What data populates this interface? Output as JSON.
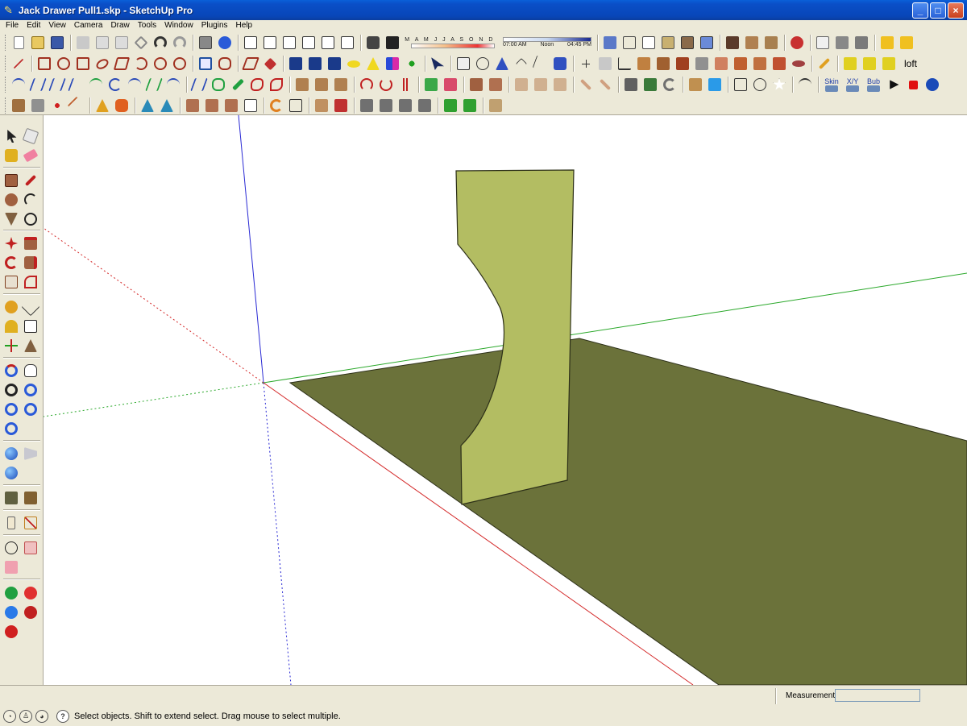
{
  "window": {
    "title": "Jack Drawer Pull1.skp - SketchUp Pro",
    "minimize_glyph": "_",
    "maximize_glyph": "□",
    "close_glyph": "×"
  },
  "menu": {
    "items": [
      {
        "label": "File"
      },
      {
        "label": "Edit"
      },
      {
        "label": "View"
      },
      {
        "label": "Camera"
      },
      {
        "label": "Draw"
      },
      {
        "label": "Tools"
      },
      {
        "label": "Window"
      },
      {
        "label": "Plugins"
      },
      {
        "label": "Help"
      }
    ]
  },
  "shadows": {
    "months": "J F M A M J J A S O N D",
    "time_start": "07:00 AM",
    "time_noon": "Noon",
    "time_end": "04:45 PM"
  },
  "plugin_labels": {
    "skin": "Skin",
    "xy": "X/Y",
    "bub": "Bub",
    "loft": "loft"
  },
  "status": {
    "hint": "Select objects. Shift to extend select. Drag mouse to select multiple.",
    "help_glyph": "?",
    "measurements_label": "Measurements",
    "measurements_value": ""
  },
  "colors": {
    "ground": "#6b723a",
    "ground_edge": "#2c2f18",
    "part_face": "#b3bd62",
    "axis_red": "#d42a2a",
    "axis_green": "#2aa82a",
    "axis_blue": "#2a2ad4"
  }
}
